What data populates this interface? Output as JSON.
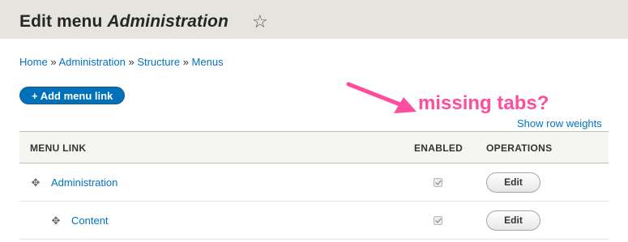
{
  "header": {
    "title_prefix": "Edit menu ",
    "title_menu": "Administration",
    "star_symbol": "☆"
  },
  "breadcrumb": {
    "items": [
      "Home",
      "Administration",
      "Structure",
      "Menus"
    ],
    "separator": "»"
  },
  "actions": {
    "add_menu_link": "+ Add menu link"
  },
  "annotation": {
    "text": "missing tabs?",
    "color": "#ff4d9d"
  },
  "table": {
    "show_row_weights": "Show row weights",
    "columns": [
      "MENU LINK",
      "ENABLED",
      "OPERATIONS"
    ],
    "rows": [
      {
        "label": "Administration",
        "enabled": true,
        "operation": "Edit",
        "depth": 0
      },
      {
        "label": "Content",
        "enabled": true,
        "operation": "Edit",
        "depth": 1
      }
    ]
  },
  "icons": {
    "drag": "drag-handle-icon",
    "star": "star-outline-icon",
    "arrow": "annotation-arrow-icon"
  },
  "colors": {
    "link": "#0074bd",
    "primary_button": "#0071b8",
    "header_bg": "#e6e4df"
  }
}
